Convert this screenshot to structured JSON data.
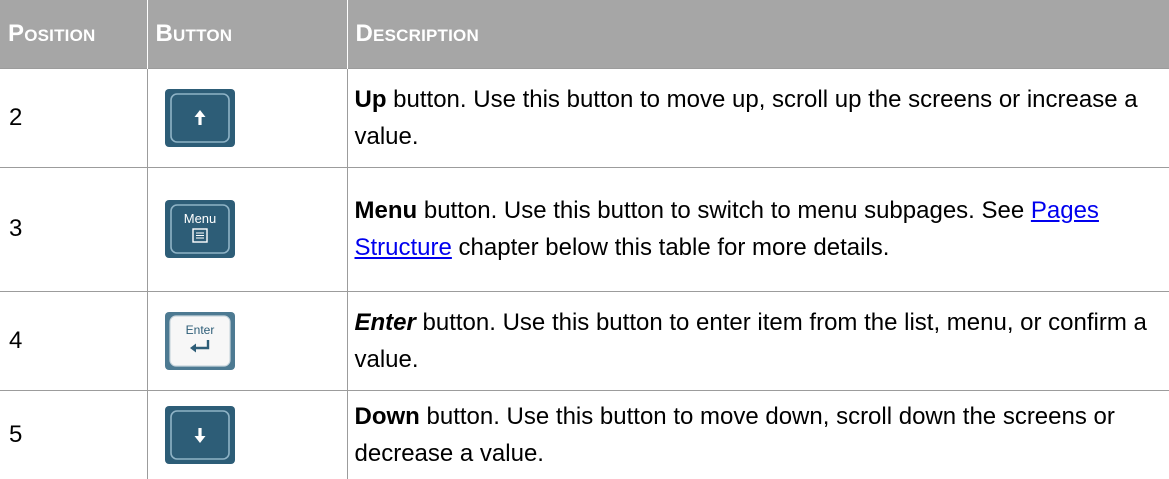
{
  "table": {
    "headers": {
      "position": "Position",
      "button": "Button",
      "description": "Description"
    },
    "rows": [
      {
        "position": "2",
        "button_icon": "up-arrow-key-icon",
        "button_style": "dark-teal",
        "desc_bold": "Up",
        "desc_rest": " button. Use this button to move up, scroll up the screens or increase a value."
      },
      {
        "position": "3",
        "button_icon": "menu-key-icon",
        "button_style": "dark-teal",
        "button_caption": "Menu",
        "desc_bold": "Menu",
        "desc_rest": " button. Use this button to switch to menu subpages. See ",
        "desc_link": "Pages Structure",
        "desc_after_link": " chapter below this table for more details."
      },
      {
        "position": "4",
        "button_icon": "enter-key-icon",
        "button_style": "light",
        "button_caption": "Enter",
        "desc_bold_italic": "Enter",
        "desc_rest": " button. Use this button to enter item from the list, menu, or confirm a value."
      },
      {
        "position": "5",
        "button_icon": "down-arrow-key-icon",
        "button_style": "dark-teal",
        "desc_bold": "Down",
        "desc_rest": " button. Use this button to move down, scroll down the screens or decrease a value."
      }
    ]
  },
  "colors": {
    "header_bg": "#a6a6a6",
    "header_text": "#ffffff",
    "grid_line": "#9c9c9c",
    "key_teal": "#2d5d77",
    "key_border": "#8fb3c6",
    "link": "#0000ee"
  }
}
